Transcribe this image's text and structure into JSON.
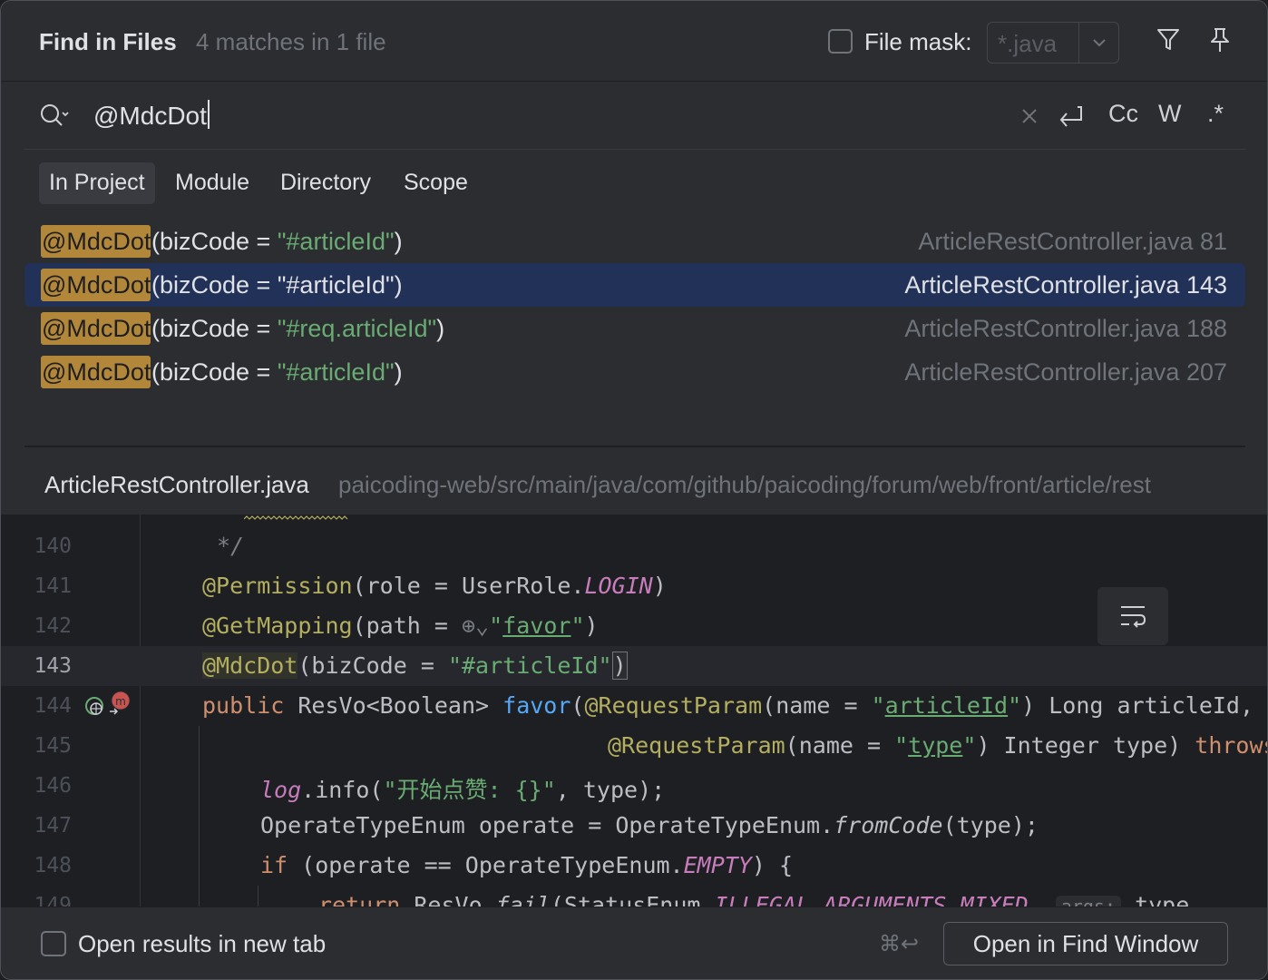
{
  "header": {
    "title": "Find in Files",
    "match_count": "4 matches in 1 file",
    "file_mask_label": "File mask:",
    "file_mask_value": "*.java",
    "file_mask_checked": false
  },
  "search": {
    "query": "@MdcDot",
    "options": {
      "match_case": "Cc",
      "words": "W",
      "regex": ".*"
    }
  },
  "scope_tabs": [
    {
      "label": "In Project",
      "active": true
    },
    {
      "label": "Module",
      "active": false
    },
    {
      "label": "Directory",
      "active": false
    },
    {
      "label": "Scope",
      "active": false
    }
  ],
  "results": [
    {
      "match": "@MdcDot",
      "pre": "(bizCode = ",
      "str": "\"#articleId\"",
      "post": ")",
      "location": "ArticleRestController.java 81",
      "selected": false
    },
    {
      "match": "@MdcDot",
      "pre": "(bizCode = ",
      "str": "\"#articleId\"",
      "post": ")",
      "location": "ArticleRestController.java 143",
      "selected": true
    },
    {
      "match": "@MdcDot",
      "pre": "(bizCode = ",
      "str": "\"#req.articleId\"",
      "post": ")",
      "location": "ArticleRestController.java 188",
      "selected": false
    },
    {
      "match": "@MdcDot",
      "pre": "(bizCode = ",
      "str": "\"#articleId\"",
      "post": ")",
      "location": "ArticleRestController.java 207",
      "selected": false
    }
  ],
  "preview": {
    "file_name": "ArticleRestController.java",
    "path": "paicoding-web/src/main/java/com/github/paicoding/forum/web/front/article/rest",
    "line_numbers": [
      "140",
      "141",
      "142",
      "143",
      "144",
      "145",
      "146",
      "147",
      "148",
      "149"
    ],
    "current_line": "143",
    "code": {
      "l140": "*/",
      "l141_ann": "@Permission",
      "l141_a": "(role = UserRole.",
      "l141_const": "LOGIN",
      "l141_b": ")",
      "l142_ann": "@GetMapping",
      "l142_a": "(path = ",
      "l142_str": "favor",
      "l142_b": ")",
      "l143_ann": "@MdcDot",
      "l143_a": "(bizCode = ",
      "l143_str": "\"#articleId\"",
      "l143_b": ")",
      "l144_kw": "public",
      "l144_a": " ResVo<Boolean> ",
      "l144_fn": "favor",
      "l144_b": "(",
      "l144_ann": "@RequestParam",
      "l144_c": "(name = ",
      "l144_str": "articleId",
      "l144_d": ") Long articleId,",
      "l145_ann": "@RequestParam",
      "l145_a": "(name = ",
      "l145_str": "type",
      "l145_b": ") Integer type) ",
      "l145_kw": "throws",
      "l146_field": "log",
      "l146_a": ".info(",
      "l146_str": "\"开始点赞: {}\"",
      "l146_b": ", type);",
      "l147_a": "OperateTypeEnum operate = OperateTypeEnum.",
      "l147_ital": "fromCode",
      "l147_b": "(type);",
      "l148_kw": "if",
      "l148_a": " (operate == OperateTypeEnum.",
      "l148_const": "EMPTY",
      "l148_b": ") {",
      "l149_kw": "return",
      "l149_a": " ResVo.",
      "l149_ital": "fail",
      "l149_b": "(StatusEnum.",
      "l149_const": "ILLEGAL_ARGUMENTS_MIXED",
      "l149_c": ", ",
      "l149_hint": "args:",
      "l149_d": " type"
    }
  },
  "footer": {
    "open_new_tab_label": "Open results in new tab",
    "open_new_tab_checked": false,
    "shortcut": "⌘↩",
    "open_button": "Open in Find Window"
  },
  "colors": {
    "background": "#2b2d30",
    "editor_background": "#1e1f22",
    "selection": "#223158",
    "match_highlight": "#b3873a",
    "string": "#6aab73",
    "annotation": "#b3ae60",
    "keyword": "#cf8e6d"
  }
}
